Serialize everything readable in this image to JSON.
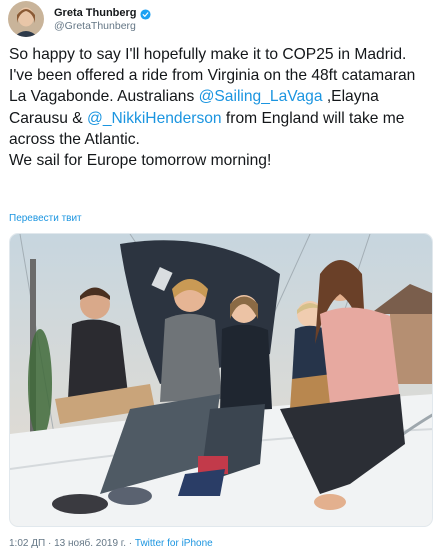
{
  "user": {
    "display_name": "Greta Thunberg",
    "handle": "@GretaThunberg",
    "avatar_icon": "avatar-photo",
    "verified_icon": "verified-badge-icon",
    "verified_color": "#1da1f2"
  },
  "tweet": {
    "line1": "So happy to say I'll hopefully make it to COP25 in Madrid.",
    "line2_pre": "I've been offered a ride from Virginia on the 48ft catamaran La Vagabonde. Australians ",
    "mention1": "@Sailing_LaVaga",
    "line2_mid": " ,Elayna Carausu & ",
    "mention2": "@_NikkiHenderson",
    "line2_post": " from England will take me across the Atlantic.",
    "line3": "We sail for Europe tomorrow morning!",
    "link_color": "#1b95e0"
  },
  "translate_link": "Перевести твит",
  "footer": {
    "time": "1:02 ДП",
    "separator": " · ",
    "date": "13 нояб. 2019 г.",
    "separator2": " · ",
    "source": "Twitter for iPhone"
  }
}
